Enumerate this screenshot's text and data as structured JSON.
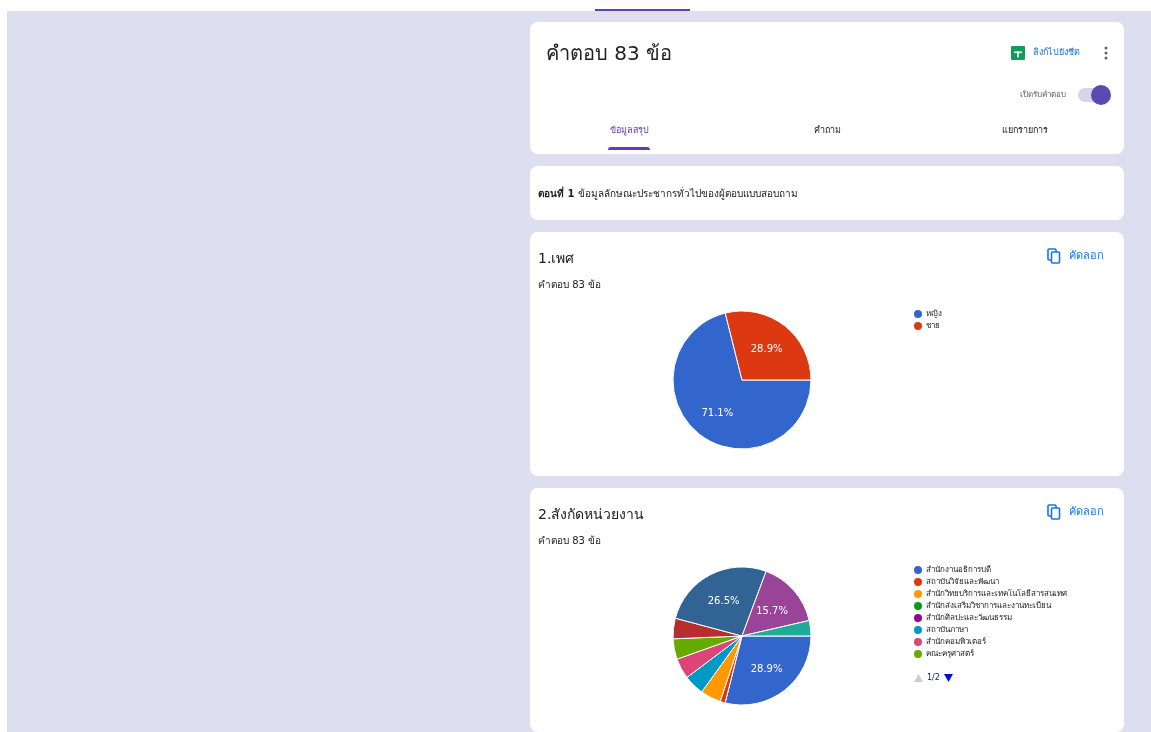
{
  "header": {
    "title": "คำตอบ 83 ข้อ",
    "sheet_link": "ลิงก์ไปยังชีต",
    "accepting_label": "เปิดรับคำตอบ",
    "accepting": true
  },
  "tabs": [
    {
      "label": "ข้อมูลสรุป",
      "selected": true
    },
    {
      "label": "คำถาม",
      "selected": false
    },
    {
      "label": "แยกรายการ",
      "selected": false
    }
  ],
  "section": {
    "text": "**ตอนที่ 1** ข้อมูลลักษณะประชากรทั่วไปของผู้ตอบแบบสอบถาม"
  },
  "questions": [
    {
      "title": "1.เพศ",
      "count": "คำตอบ 83 ข้อ",
      "copy": "คัดลอก",
      "legend": [
        {
          "label": "หญิง",
          "color": "#3366cc"
        },
        {
          "label": "ชาย",
          "color": "#dc3912"
        }
      ],
      "chart_data": {
        "type": "pie",
        "values": [
          71.1,
          28.9
        ],
        "colors": [
          "#3366cc",
          "#dc3912"
        ],
        "value_labels": [
          "71.1%",
          "28.9%"
        ]
      }
    },
    {
      "title": "2.สังกัดหน่วยงาน",
      "count": "คำตอบ 83 ข้อ",
      "copy": "คัดลอก",
      "pager": "1/2",
      "legend": [
        {
          "label": "สำนักงานอธิการบดี",
          "color": "#3366cc"
        },
        {
          "label": "สถาบันวิจัยและพัฒนา",
          "color": "#dc3912"
        },
        {
          "label": "สำนักวิทยบริการและเทคโนโลยีสารสนเทศ",
          "color": "#ff9900"
        },
        {
          "label": "สำนักส่งเสริมวิชาการและงานทะเบียน",
          "color": "#109618"
        },
        {
          "label": "สำนักศิลปะและวัฒนธรรม",
          "color": "#990099"
        },
        {
          "label": "สถาบันภาษา",
          "color": "#0099c6"
        },
        {
          "label": "สำนักคอมพิวเตอร์",
          "color": "#dd4477"
        },
        {
          "label": "คณะครุศาสตร์",
          "color": "#66aa00"
        }
      ],
      "chart_data": {
        "type": "pie",
        "values": [
          28.9,
          1.2,
          4.8,
          4.8,
          4.8,
          4.8,
          4.8,
          26.5,
          15.7,
          3.6
        ],
        "colors": [
          "#3366cc",
          "#dc3912",
          "#ff9900",
          "#0099c6",
          "#dd4477",
          "#66aa00",
          "#b82e2e",
          "#316395",
          "#994499",
          "#22aa99"
        ],
        "value_labels": [
          "28.9%",
          null,
          null,
          null,
          null,
          null,
          null,
          "26.5%",
          "15.7%",
          null
        ]
      }
    }
  ]
}
